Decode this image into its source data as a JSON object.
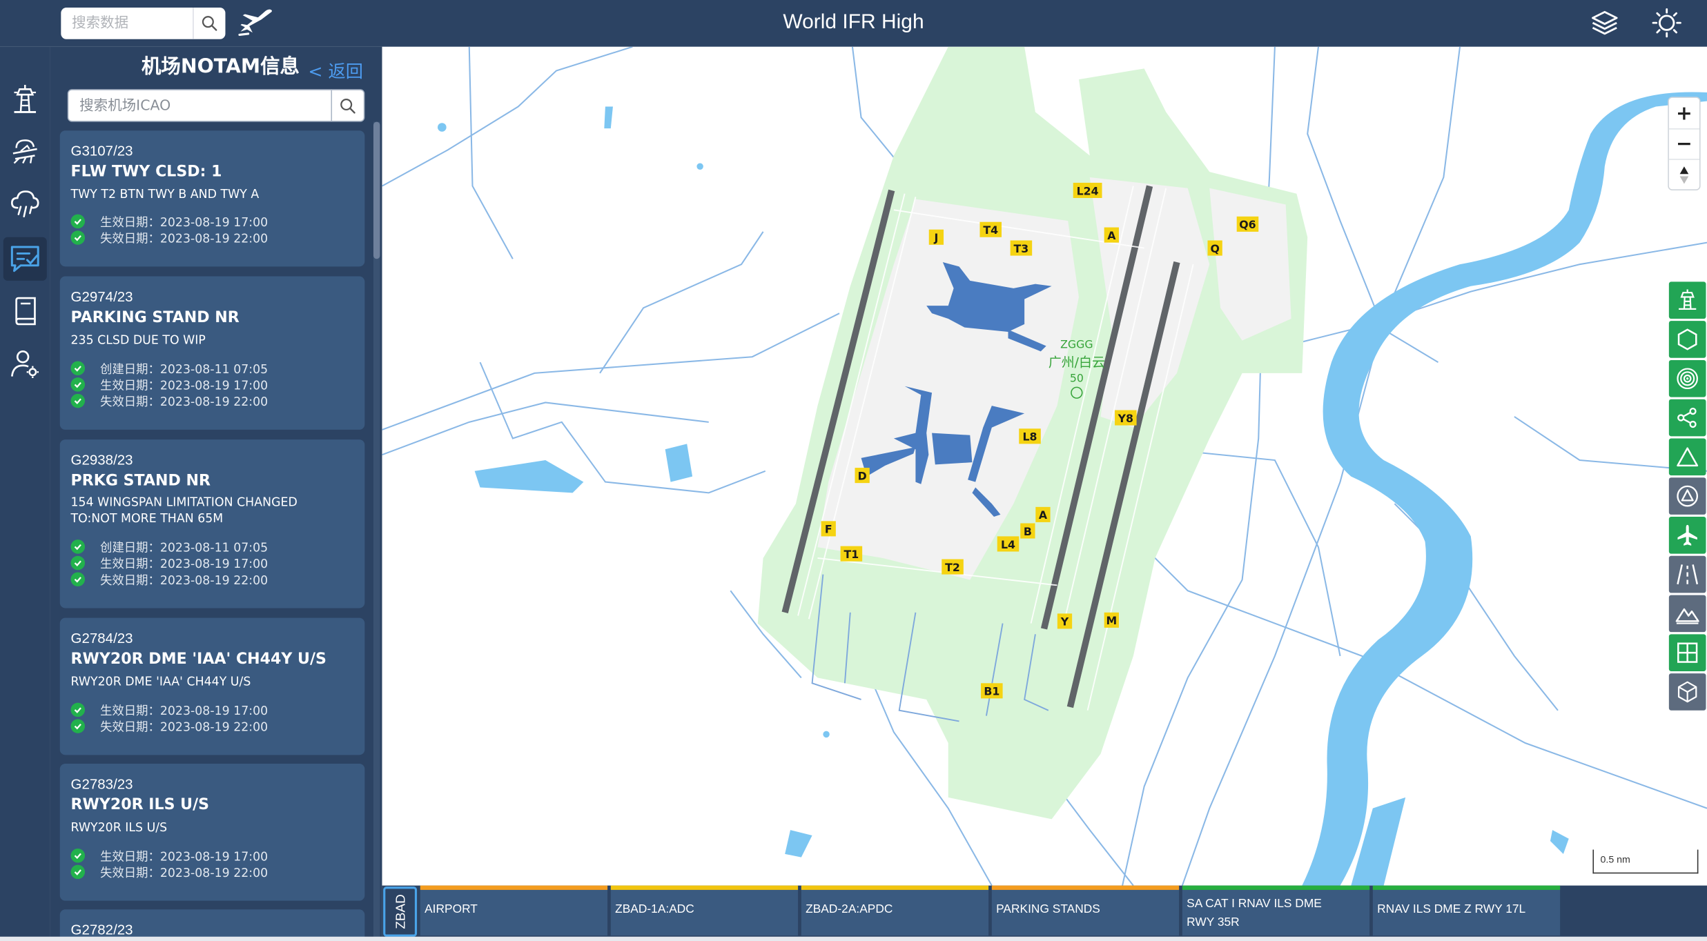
{
  "header": {
    "search_placeholder": "搜索数据",
    "title": "World IFR High",
    "icons": [
      "search-icon",
      "plane-logo-icon",
      "layers-icon",
      "sun-icon"
    ]
  },
  "rail": {
    "items": [
      {
        "name": "airport-tower-icon",
        "active": false
      },
      {
        "name": "weather-airport-icon",
        "active": false
      },
      {
        "name": "weather-cloud-rain-icon",
        "active": false
      },
      {
        "name": "notam-message-icon",
        "active": true
      },
      {
        "name": "book-icon",
        "active": false
      },
      {
        "name": "user-settings-icon",
        "active": false
      }
    ]
  },
  "panel": {
    "title": "机场NOTAM信息",
    "back_label": "< 返回",
    "search_placeholder": "搜索机场ICAO",
    "cards": [
      {
        "id": "G3107/23",
        "title": "FLW TWY CLSD: 1",
        "desc": [
          "TWY T2 BTN TWY B AND TWY A"
        ],
        "dates": [
          "生效日期：2023-08-19 17:00",
          "失效日期：2023-08-19 22:00"
        ]
      },
      {
        "id": "G2974/23",
        "title": "PARKING STAND NR",
        "desc": [
          "235 CLSD DUE TO WIP"
        ],
        "dates": [
          "创建日期：2023-08-11 07:05",
          "生效日期：2023-08-19 17:00",
          "失效日期：2023-08-19 22:00"
        ]
      },
      {
        "id": "G2938/23",
        "title": "PRKG STAND NR",
        "desc": [
          "154 WINGSPAN LIMITATION CHANGED",
          "TO:NOT MORE THAN 65M"
        ],
        "dates": [
          "创建日期：2023-08-11 07:05",
          "生效日期：2023-08-19 17:00",
          "失效日期：2023-08-19 22:00"
        ]
      },
      {
        "id": "G2784/23",
        "title": "RWY20R DME 'IAA' CH44Y U/S",
        "desc": [
          "RWY20R DME 'IAA' CH44Y U/S"
        ],
        "dates": [
          "生效日期：2023-08-19 17:00",
          "失效日期：2023-08-19 22:00"
        ]
      },
      {
        "id": "G2783/23",
        "title": "RWY20R ILS U/S",
        "desc": [
          "RWY20R ILS U/S"
        ],
        "dates": [
          "生效日期：2023-08-19 17:00",
          "失效日期：2023-08-19 22:00"
        ]
      },
      {
        "id": "G2782/23",
        "title": "",
        "desc": [],
        "dates": []
      }
    ]
  },
  "map": {
    "airport_code": "ZGGG",
    "airport_name": "广州/白云",
    "elevation": "50",
    "taxiway_labels": [
      "L24",
      "T4",
      "J",
      "T3",
      "A",
      "Q6",
      "Q",
      "Y8",
      "L8",
      "D",
      "A",
      "B",
      "L4",
      "F",
      "T1",
      "T2",
      "Y",
      "M",
      "B1"
    ],
    "scale_label": "0.5 nm",
    "colors": {
      "water": "#7cc6f2",
      "airport_area": "#d9f5d8",
      "runway": "#606468",
      "terminal": "#4a7cc1",
      "road": "#8ab8e6",
      "label_bg": "#f5d312"
    },
    "zoom_controls": [
      "+",
      "−"
    ],
    "layer_tools": [
      {
        "name": "airport-tower-layer-icon",
        "color": "#22a555"
      },
      {
        "name": "hexagon-layer-icon",
        "color": "#22a555"
      },
      {
        "name": "target-layer-icon",
        "color": "#22a555"
      },
      {
        "name": "share-network-layer-icon",
        "color": "#22a555"
      },
      {
        "name": "triangle-layer-icon",
        "color": "#22a555"
      },
      {
        "name": "circle-triangle-layer-icon",
        "color": "#5d6b7e"
      },
      {
        "name": "airplane-layer-icon",
        "color": "#22a555"
      },
      {
        "name": "road-layer-icon",
        "color": "#5d6b7e"
      },
      {
        "name": "mountain-layer-icon",
        "color": "#5d6b7e"
      },
      {
        "name": "grid-layer-icon",
        "color": "#22a555"
      },
      {
        "name": "cube-layer-icon",
        "color": "#5d6b7e"
      }
    ]
  },
  "chart_tabs": {
    "airport": "ZBAD",
    "tabs": [
      {
        "label": "AIRPORT",
        "color": "#f39c1f"
      },
      {
        "label": "ZBAD-1A:ADC",
        "color": "#f1c40f"
      },
      {
        "label": "ZBAD-2A:APDC",
        "color": "#f1c40f"
      },
      {
        "label": "PARKING STANDS",
        "color": "#f39c1f"
      },
      {
        "label": "SA CAT I RNAV ILS DME RWY 35R",
        "color": "#27ae3f"
      },
      {
        "label": "RNAV ILS DME Z RWY 17L",
        "color": "#27ae3f"
      }
    ]
  }
}
